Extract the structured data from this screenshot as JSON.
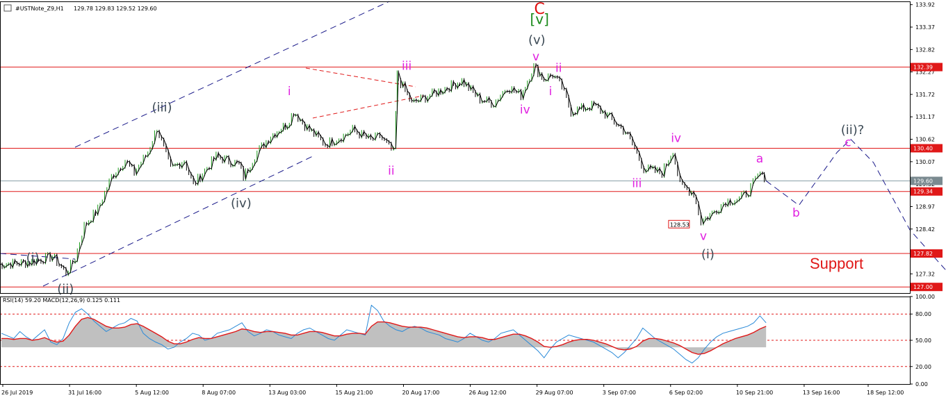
{
  "header": {
    "symbol": "#USTNote_Z9,H1",
    "ohlc": "129.78 129.83 129.52 129.60"
  },
  "indicator_header": "RSI(14) 59.20 MACD(12,26,9) 0.125 0.111",
  "colors": {
    "candle": "#000000",
    "up_wick": "#1a9a1a",
    "level": "#e01818",
    "channel": "#1a1a8a",
    "wave_pink": "#e020e0",
    "wave_gray": "#3c4a55",
    "rsi": "#2a8ad8",
    "macd_signal": "#e01818",
    "macd_hist": "#c0c0c0"
  },
  "annotations": {
    "support": "Support",
    "low_marker": "128.53"
  },
  "chart_data": [
    {
      "type": "line",
      "title": "#USTNote_Z9,H1",
      "ylim": [
        126.85,
        134.0
      ],
      "y_ticks": [
        "133.92",
        "133.37",
        "132.82",
        "132.27",
        "131.72",
        "131.17",
        "130.62",
        "130.07",
        "129.52",
        "128.97",
        "128.42",
        "127.87",
        "127.32"
      ],
      "x_ticks": [
        "26 Jul 2019",
        "31 Jul 16:00",
        "5 Aug 12:00",
        "8 Aug 07:00",
        "13 Aug 03:00",
        "15 Aug 21:00",
        "20 Aug 17:00",
        "26 Aug 12:00",
        "29 Aug 07:00",
        "3 Sep 07:00",
        "6 Sep 02:00",
        "10 Sep 21:00",
        "13 Sep 16:00",
        "18 Sep 12:00"
      ],
      "price_path": [
        [
          0,
          127.55
        ],
        [
          0.035,
          127.6
        ],
        [
          0.06,
          127.75
        ],
        [
          0.075,
          127.35
        ],
        [
          0.085,
          127.7
        ],
        [
          0.095,
          128.5
        ],
        [
          0.11,
          128.9
        ],
        [
          0.125,
          129.7
        ],
        [
          0.14,
          130.1
        ],
        [
          0.15,
          129.8
        ],
        [
          0.165,
          130.3
        ],
        [
          0.175,
          130.9
        ],
        [
          0.19,
          129.9
        ],
        [
          0.205,
          130.1
        ],
        [
          0.215,
          129.5
        ],
        [
          0.24,
          130.2
        ],
        [
          0.265,
          130.0
        ],
        [
          0.27,
          129.7
        ],
        [
          0.285,
          130.3
        ],
        [
          0.3,
          130.7
        ],
        [
          0.318,
          131.0
        ],
        [
          0.325,
          131.3
        ],
        [
          0.34,
          130.9
        ],
        [
          0.36,
          130.5
        ],
        [
          0.38,
          130.7
        ],
        [
          0.39,
          130.85
        ],
        [
          0.41,
          130.6
        ],
        [
          0.42,
          130.7
        ],
        [
          0.435,
          130.3
        ],
        [
          0.438,
          132.2
        ],
        [
          0.455,
          131.5
        ],
        [
          0.475,
          131.7
        ],
        [
          0.51,
          132.05
        ],
        [
          0.53,
          131.6
        ],
        [
          0.545,
          131.5
        ],
        [
          0.56,
          131.9
        ],
        [
          0.575,
          131.7
        ],
        [
          0.589,
          132.4
        ],
        [
          0.6,
          132.1
        ],
        [
          0.61,
          132.2
        ],
        [
          0.62,
          131.9
        ],
        [
          0.63,
          131.3
        ],
        [
          0.655,
          131.45
        ],
        [
          0.67,
          131.2
        ],
        [
          0.69,
          130.8
        ],
        [
          0.7,
          130.4
        ],
        [
          0.71,
          129.9
        ],
        [
          0.73,
          129.8
        ],
        [
          0.742,
          130.35
        ],
        [
          0.75,
          129.5
        ],
        [
          0.765,
          129.3
        ],
        [
          0.773,
          128.6
        ],
        [
          0.785,
          128.8
        ],
        [
          0.8,
          129.1
        ],
        [
          0.815,
          129.15
        ],
        [
          0.825,
          129.35
        ],
        [
          0.838,
          129.78
        ],
        [
          0.842,
          129.6
        ]
      ],
      "forecast_path": [
        [
          0.842,
          129.6
        ],
        [
          0.865,
          129.22
        ],
        [
          0.878,
          129.0
        ],
        [
          0.92,
          130.3
        ],
        [
          0.935,
          130.62
        ],
        [
          0.96,
          130.05
        ],
        [
          1.0,
          128.4
        ],
        [
          1.06,
          126.9
        ]
      ],
      "levels": [
        {
          "value": 132.39,
          "label": "132.39"
        },
        {
          "value": 130.4,
          "label": "130.40"
        },
        {
          "value": 129.34,
          "label": "129.34"
        },
        {
          "value": 127.82,
          "label": "127.82"
        },
        {
          "value": 127.0,
          "label": "127.00"
        }
      ],
      "current_price": {
        "value": 129.6,
        "label": "129.60"
      },
      "wave_labels": [
        {
          "text": "C",
          "x": 0.593,
          "y": 133.95,
          "style": "red"
        },
        {
          "text": "[v]",
          "x": 0.593,
          "y": 133.45,
          "style": "green"
        },
        {
          "text": "(v)",
          "x": 0.59,
          "y": 132.95,
          "style": "gray"
        },
        {
          "text": "v",
          "x": 0.589,
          "y": 132.55,
          "style": "pink"
        },
        {
          "text": "ii",
          "x": 0.614,
          "y": 132.27,
          "style": "pink"
        },
        {
          "text": "iii",
          "x": 0.447,
          "y": 132.32,
          "style": "pink"
        },
        {
          "text": "i",
          "x": 0.605,
          "y": 131.7,
          "style": "pink"
        },
        {
          "text": "iv",
          "x": 0.577,
          "y": 131.25,
          "style": "pink"
        },
        {
          "text": "(iii)",
          "x": 0.178,
          "y": 131.3,
          "style": "gray"
        },
        {
          "text": "i",
          "x": 0.318,
          "y": 131.7,
          "style": "pink"
        },
        {
          "text": "ii",
          "x": 0.43,
          "y": 129.75,
          "style": "pink"
        },
        {
          "text": "(iv)",
          "x": 0.265,
          "y": 128.95,
          "style": "gray"
        },
        {
          "text": "(i)",
          "x": 0.036,
          "y": 127.62,
          "style": "gray"
        },
        {
          "text": "(ii)",
          "x": 0.072,
          "y": 126.85,
          "style": "gray"
        },
        {
          "text": "iv",
          "x": 0.743,
          "y": 130.55,
          "style": "pink"
        },
        {
          "text": "iii",
          "x": 0.7,
          "y": 129.45,
          "style": "pink"
        },
        {
          "text": "v",
          "x": 0.773,
          "y": 128.15,
          "style": "pink"
        },
        {
          "text": "(i)",
          "x": 0.778,
          "y": 127.7,
          "style": "gray"
        },
        {
          "text": "a",
          "x": 0.835,
          "y": 130.05,
          "style": "pink"
        },
        {
          "text": "b",
          "x": 0.875,
          "y": 128.72,
          "style": "pink"
        },
        {
          "text": "c",
          "x": 0.932,
          "y": 130.45,
          "style": "pink"
        },
        {
          "text": "(ii)?",
          "x": 0.937,
          "y": 130.75,
          "style": "gray"
        }
      ]
    },
    {
      "type": "line",
      "title": "RSI(14) 59.20 MACD(12,26,9) 0.125 0.111",
      "ylim": [
        0,
        100
      ],
      "y_ticks": [
        "100.00",
        "80.00",
        "50.00",
        "20.00",
        "0.00"
      ],
      "levels": [
        80,
        50,
        20
      ],
      "series": [
        {
          "values": [
            58,
            55,
            52,
            60,
            54,
            50,
            56,
            62,
            48,
            45,
            52,
            70,
            82,
            86,
            80,
            72,
            66,
            60,
            64,
            68,
            70,
            75,
            72,
            58,
            52,
            48,
            45,
            40,
            42,
            48,
            52,
            58,
            56,
            50,
            52,
            58,
            60,
            62,
            66,
            70,
            60,
            55,
            58,
            62,
            60,
            56,
            54,
            52,
            58,
            62,
            64,
            60,
            56,
            52,
            50,
            56,
            62,
            60,
            58,
            56,
            90,
            84,
            72,
            66,
            62,
            60,
            64,
            66,
            64,
            60,
            58,
            56,
            52,
            50,
            48,
            52,
            58,
            54,
            50,
            48,
            52,
            58,
            60,
            62,
            56,
            50,
            44,
            38,
            30,
            40,
            48,
            52,
            56,
            54,
            52,
            50,
            48,
            44,
            40,
            36,
            30,
            36,
            44,
            52,
            64,
            58,
            52,
            48,
            44,
            40,
            34,
            28,
            24,
            30,
            40,
            48,
            54,
            58,
            60,
            62,
            64,
            66,
            70,
            78,
            70
          ]
        },
        {
          "values": [
            52,
            52,
            51,
            52,
            52,
            50,
            51,
            53,
            50,
            48,
            49,
            56,
            66,
            74,
            76,
            74,
            70,
            66,
            64,
            64,
            65,
            68,
            69,
            66,
            62,
            58,
            54,
            49,
            46,
            46,
            48,
            51,
            53,
            52,
            52,
            54,
            56,
            58,
            60,
            63,
            62,
            60,
            59,
            60,
            60,
            59,
            58,
            56,
            56,
            58,
            60,
            60,
            59,
            57,
            55,
            55,
            57,
            58,
            58,
            57,
            66,
            71,
            71,
            70,
            68,
            66,
            65,
            65,
            65,
            64,
            62,
            60,
            58,
            56,
            54,
            53,
            54,
            54,
            53,
            51,
            51,
            53,
            55,
            57,
            57,
            55,
            52,
            48,
            43,
            42,
            43,
            45,
            48,
            50,
            51,
            51,
            50,
            48,
            46,
            43,
            40,
            39,
            40,
            43,
            49,
            52,
            52,
            51,
            49,
            47,
            44,
            40,
            36,
            34,
            35,
            38,
            42,
            46,
            49,
            52,
            54,
            56,
            59,
            63,
            66
          ]
        }
      ]
    }
  ]
}
